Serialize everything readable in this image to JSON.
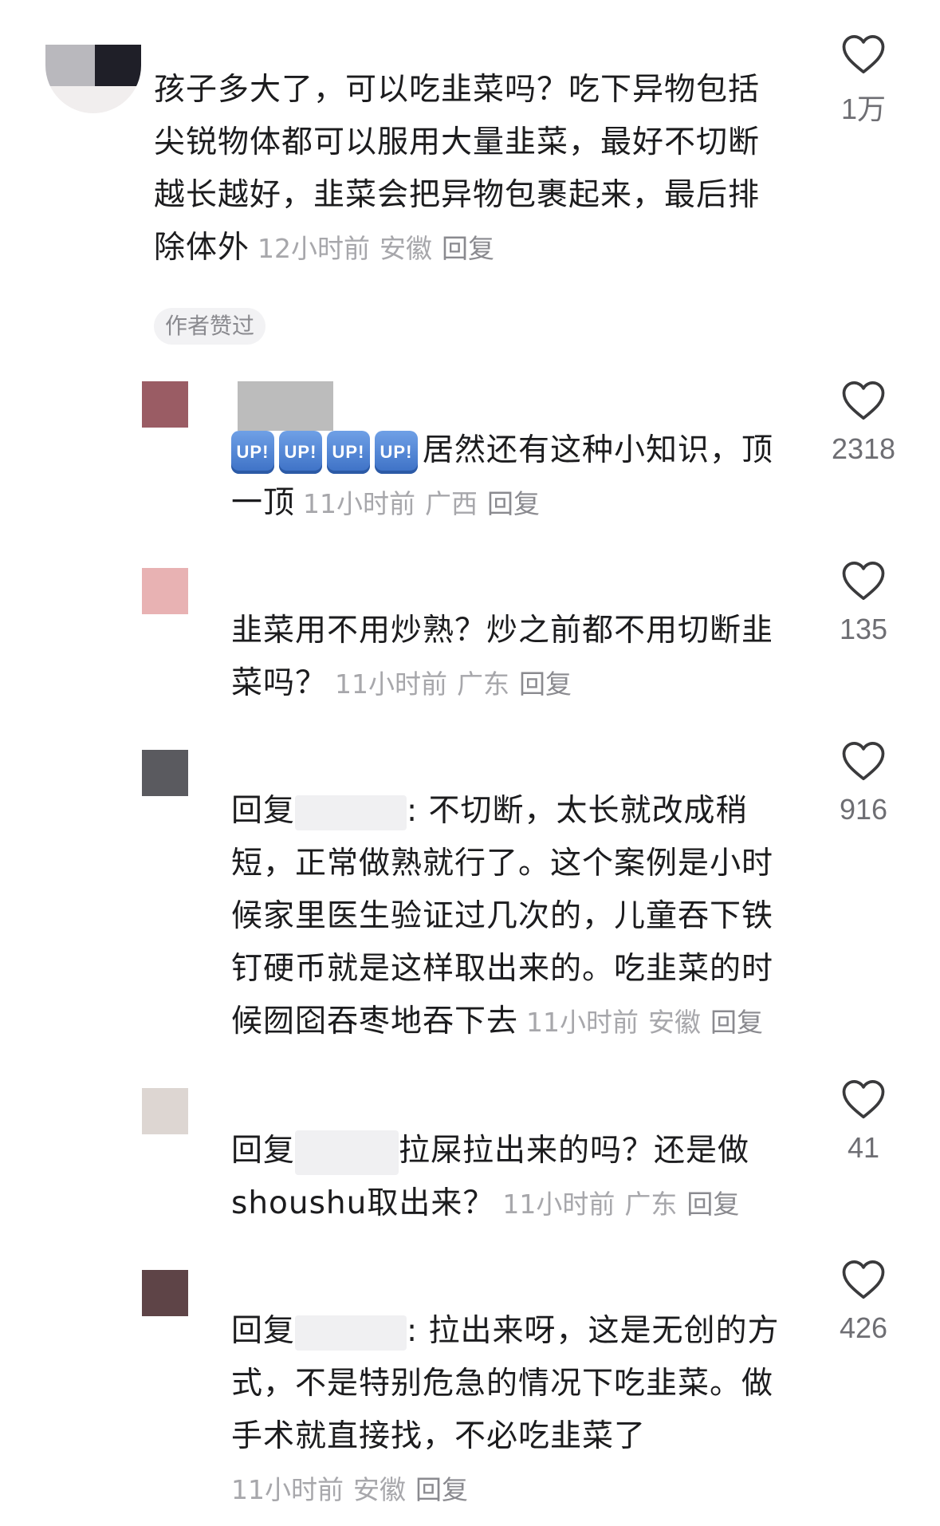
{
  "comments": [
    {
      "text": "孩子多大了，可以吃韭菜吗？吃下异物包括尖锐物体都可以服用大量韭菜，最好不切断越长越好，韭菜会把异物包裹起来，最后排除体外",
      "lines": [
        "孩子多大了，可以吃韭菜吗？吃下异物包括",
        "尖锐物体都可以服用大量韭菜，最好不切断",
        "越长越好，韭菜会把异物包裹起来，最后排",
        "除体外"
      ],
      "time": "12小时前",
      "location": "安徽",
      "reply": "回复",
      "likes": "1万",
      "badge": "作者赞过"
    },
    {
      "badges": [
        "UP!",
        "UP!",
        "UP!",
        "UP!"
      ],
      "lines": [
        "居然还有这种小知识，顶",
        "一顶"
      ],
      "time": "11小时前",
      "location": "广西",
      "reply": "回复",
      "likes": "2318",
      "avatar_color": "#9a5c64"
    },
    {
      "lines": [
        "韭菜用不用炒熟？炒之前都不用切断韭",
        "菜吗？"
      ],
      "time": "11小时前",
      "location": "广东",
      "reply": "回复",
      "likes": "135",
      "avatar_color": "#e8b2b3"
    },
    {
      "prefix": "回复",
      "lines": [
        ": 不切断，太长就改成稍",
        "短，正常做熟就行了。这个案例是小时",
        "候家里医生验证过几次的，儿童吞下铁",
        "钉硬币就是这样取出来的。吃韭菜的时",
        "候囫囵吞枣地吞下去"
      ],
      "time": "11小时前",
      "location": "安徽",
      "reply": "回复",
      "likes": "916",
      "avatar_color": "#5a5a5f"
    },
    {
      "prefix": "回复",
      "lines": [
        "拉屎拉出来的吗？还是做",
        "shoushu取出来？"
      ],
      "time": "11小时前",
      "location": "广东",
      "reply": "回复",
      "likes": "41",
      "avatar_color": "#ddd6d2"
    },
    {
      "prefix": "回复",
      "lines": [
        ": 拉出来呀，这是无创的方",
        "式，不是特别危急的情况下吃韭菜。做",
        "手术就直接找，不必吃韭菜了"
      ],
      "time": "11小时前",
      "location": "安徽",
      "reply": "回复",
      "likes": "426",
      "avatar_color": "#5e4447"
    }
  ],
  "icons": {
    "like": "heart-outline-icon"
  },
  "colors": {
    "meta": "#a7a7ab",
    "text": "#1c1c1e",
    "like_count": "#6e6e73"
  }
}
